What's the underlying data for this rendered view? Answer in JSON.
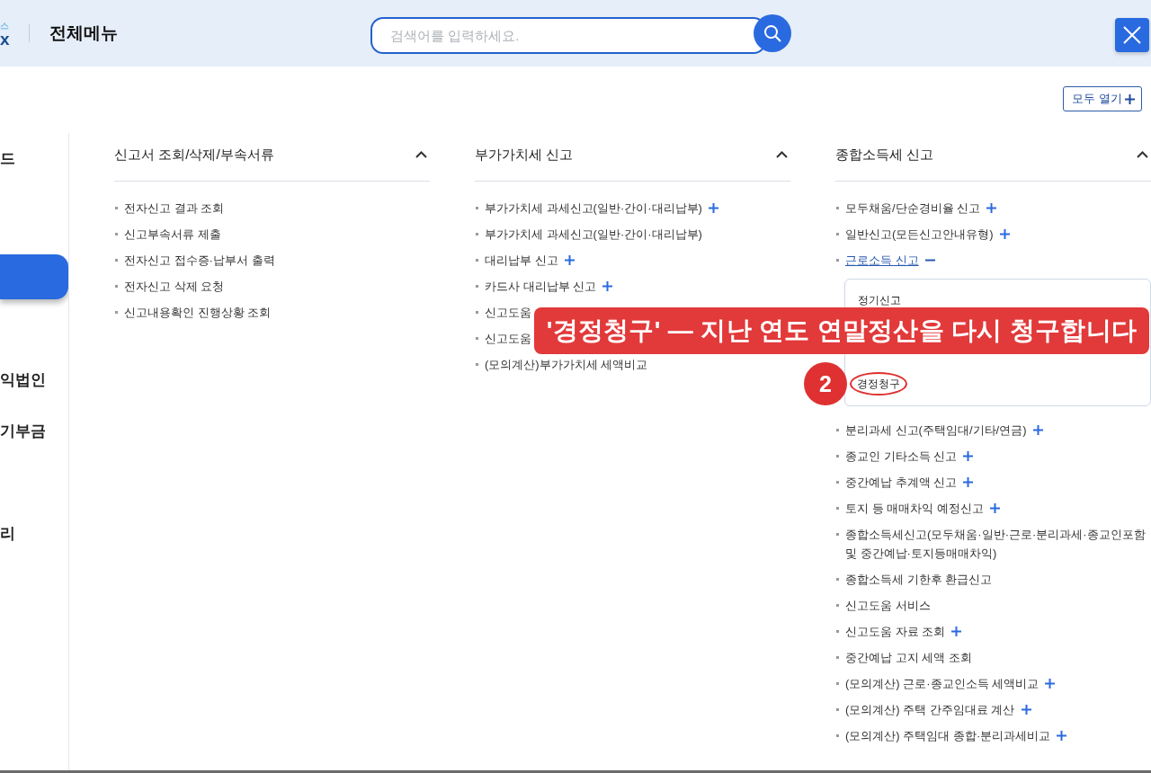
{
  "header": {
    "logo_top": "스",
    "logo_bottom": "x",
    "title": "전체메뉴",
    "search": {
      "placeholder": "검색어를 입력하세요."
    }
  },
  "toolbar": {
    "expand_all": "모두 열기"
  },
  "sidebar": {
    "items": [
      {
        "label": "드",
        "selected": false
      },
      {
        "selected": false
      },
      {
        "selected": true
      },
      {
        "selected": false
      },
      {
        "label": "익법인",
        "selected": false
      },
      {
        "label": "기부금",
        "selected": false
      },
      {
        "selected": false
      },
      {
        "label": "리",
        "selected": false
      }
    ]
  },
  "columns": [
    {
      "title": "신고서 조회/삭제/부속서류",
      "expanded": true,
      "items": [
        {
          "label": "전자신고 결과 조회",
          "kind": "link"
        },
        {
          "label": "신고부속서류 제출",
          "kind": "link"
        },
        {
          "label": "전자신고 접수증·납부서 출력",
          "kind": "link"
        },
        {
          "label": "전자신고 삭제 요청",
          "kind": "link"
        },
        {
          "label": "신고내용확인 진행상황 조회",
          "kind": "link"
        }
      ]
    },
    {
      "title": "부가가치세 신고",
      "expanded": true,
      "items": [
        {
          "label": "부가가치세 과세신고(일반·간이·대리납부)",
          "kind": "toggle",
          "expanded": false
        },
        {
          "label": "부가가치세 과세신고(일반·간이·대리납부)",
          "kind": "link"
        },
        {
          "label": "대리납부 신고",
          "kind": "toggle",
          "expanded": false
        },
        {
          "label": "카드사 대리납부 신고",
          "kind": "toggle",
          "expanded": false
        },
        {
          "label": "신고도움",
          "kind": "link"
        },
        {
          "label": "신고도움",
          "kind": "link"
        },
        {
          "label": "(모의계산)부가가치세 세액비교",
          "kind": "link"
        }
      ]
    },
    {
      "title": "종합소득세 신고",
      "expanded": true,
      "items": [
        {
          "label": "모두채움/단순경비율 신고",
          "kind": "toggle",
          "expanded": false
        },
        {
          "label": "일반신고(모든신고안내유형)",
          "kind": "toggle",
          "expanded": false
        },
        {
          "label": "근로소득 신고",
          "kind": "toggle",
          "expanded": true,
          "children": [
            {
              "label": "정기신고",
              "circled": false
            },
            {
              "label": "경정청구",
              "circled": true
            }
          ]
        },
        {
          "label": "분리과세 신고(주택임대/기타/연금)",
          "kind": "toggle",
          "expanded": false
        },
        {
          "label": "종교인 기타소득 신고",
          "kind": "toggle",
          "expanded": false
        },
        {
          "label": "중간예납 추계액 신고",
          "kind": "toggle",
          "expanded": false
        },
        {
          "label": "토지 등 매매차익 예정신고",
          "kind": "toggle",
          "expanded": false
        },
        {
          "label": "종합소득세신고(모두채움·일반·근로·분리과세·종교인포함 및 중간예납·토지등매매차익)",
          "kind": "link"
        },
        {
          "label": "종합소득세 기한후 환급신고",
          "kind": "link"
        },
        {
          "label": "신고도움 서비스",
          "kind": "link"
        },
        {
          "label": "신고도움 자료 조회",
          "kind": "toggle",
          "expanded": false
        },
        {
          "label": "중간예납 고지 세액 조회",
          "kind": "link"
        },
        {
          "label": "(모의계산) 근로·종교인소득 세액비교",
          "kind": "toggle",
          "expanded": false
        },
        {
          "label": "(모의계산) 주택 간주임대료 계산",
          "kind": "toggle",
          "expanded": false
        },
        {
          "label": "(모의계산) 주택임대 종합·분리과세비교",
          "kind": "toggle",
          "expanded": false
        }
      ]
    }
  ],
  "annotation": {
    "banner": "'경정청구' — 지난 연도 연말정산을 다시 청구합니다",
    "step": "2"
  }
}
